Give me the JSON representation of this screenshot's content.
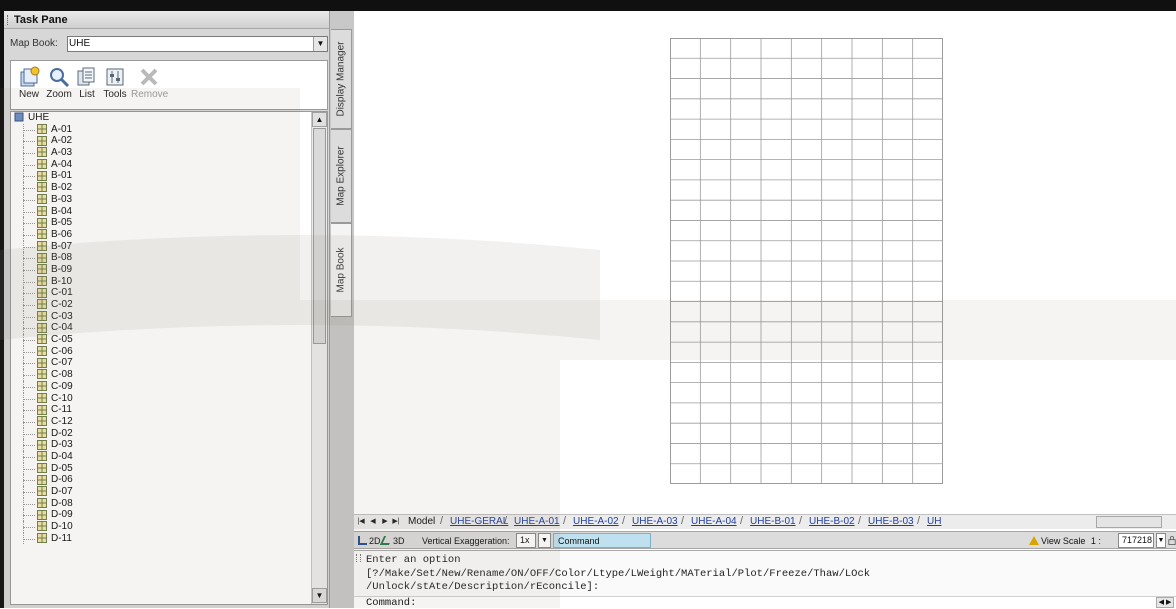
{
  "task_pane": {
    "title": "Task Pane",
    "map_book_label": "Map Book:",
    "map_book_value": "UHE",
    "toolbar": {
      "new": "New",
      "zoom": "Zoom",
      "list": "List",
      "tools": "Tools",
      "remove": "Remove"
    },
    "tree_root": "UHE",
    "tree_items": [
      "A-01",
      "A-02",
      "A-03",
      "A-04",
      "B-01",
      "B-02",
      "B-03",
      "B-04",
      "B-05",
      "B-06",
      "B-07",
      "B-08",
      "B-09",
      "B-10",
      "C-01",
      "C-02",
      "C-03",
      "C-04",
      "C-05",
      "C-06",
      "C-07",
      "C-08",
      "C-09",
      "C-10",
      "C-11",
      "C-12",
      "D-02",
      "D-03",
      "D-04",
      "D-05",
      "D-06",
      "D-07",
      "D-08",
      "D-09",
      "D-10",
      "D-11"
    ]
  },
  "side_tabs": {
    "display_manager": "Display Manager",
    "map_explorer": "Map Explorer",
    "map_book": "Map Book"
  },
  "layout_tabs": [
    "Model",
    "UHE-GERAL",
    "UHE-A-01",
    "UHE-A-02",
    "UHE-A-03",
    "UHE-A-04",
    "UHE-B-01",
    "UHE-B-02",
    "UHE-B-03",
    "UH"
  ],
  "statusbar": {
    "mode_2d": "2D",
    "mode_3d": "3D",
    "vertical_exaggeration_label": "Vertical Exaggeration:",
    "vertical_exaggeration_value": "1x",
    "command_label": "Command",
    "view_scale_label": "View Scale",
    "view_scale_prefix": "1 :",
    "view_scale_value": "717218"
  },
  "command_window": {
    "line1": "Enter an option",
    "line2": "[?/Make/Set/New/Rename/ON/OFF/Color/Ltype/LWeight/MATerial/Plot/Freeze/Thaw/LOck",
    "line3": "/Unlock/stAte/Description/rEconcile]:",
    "prompt": "Command:"
  },
  "grid": {
    "columns": 9,
    "rows": 22
  },
  "colors": {
    "frame": "#101010",
    "panel": "#d7d7d7",
    "link": "#1f3ea0",
    "grid_line": "#9c9c9c"
  },
  "icons": [
    "new-map-icon",
    "zoom-magnifier-icon",
    "list-icon",
    "tools-icon",
    "remove-icon",
    "map-book-icon",
    "map-sheet-icon",
    "warning-icon",
    "lock-icon"
  ]
}
